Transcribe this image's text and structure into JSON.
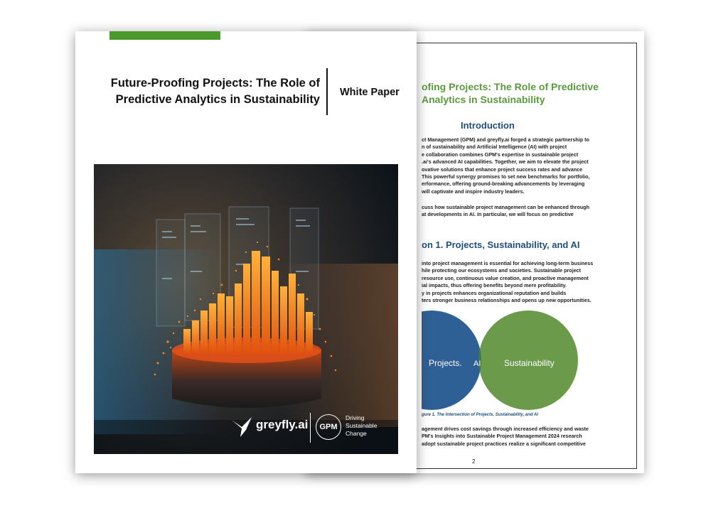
{
  "front": {
    "title_line1": "Future-Proofing Projects: The Role of",
    "title_line2": "Predictive Analytics in Sustainability",
    "doc_type": "White Paper",
    "logo_greyfly": "greyfly.ai",
    "logo_gpm": "GPM",
    "tagline_line1": "Driving",
    "tagline_line2": "Sustainable",
    "tagline_line3": "Change"
  },
  "back": {
    "title_line1": "ofing Projects: The Role of Predictive",
    "title_line2": "Analytics in Sustainability",
    "intro_heading": "Introduction",
    "intro_lines": [
      "ct Management (GPM) and greyfly.ai forged a strategic partnership to",
      "n of sustainability and Artificial Intelligence (AI) with project",
      "e collaboration combines GPM's expertise in sustainable project",
      ".ai's advanced AI capabilities. Together, we aim to elevate the project",
      "ovative solutions that enhance project success rates and advance",
      "This powerful synergy promises to set new benchmarks for portfolio,",
      "erformance, offering ground-breaking advancements by leveraging",
      "will captivate and inspire industry leaders."
    ],
    "intro2_lines": [
      "cuss how sustainable project management can be enhanced through",
      "at developments in AI. In particular, we will focus on predictive"
    ],
    "section_heading": "on 1. Projects, Sustainability, and AI",
    "section_lines": [
      "into project management is essential for achieving long-term business",
      "hile protecting our ecosystems and societies. Sustainable project",
      "resource use, continuous value creation, and proactive management",
      "ial impacts, thus offering benefits beyond mere profitability.",
      "y in projects enhances organizational reputation and builds",
      "ters stronger business relationships and opens up new opportunities."
    ],
    "venn_left": "Projects.",
    "venn_center": "AI",
    "venn_right": "Sustainability",
    "caption": "gure 1. The Intersection of Projects, Sustainability, and AI",
    "closing_lines": [
      "agement drives cost savings through increased efficiency and waste",
      "PM's Insights into Sustainable Project Management 2024 research",
      "adopt sustainable project practices realize a significant competitive"
    ],
    "page_number": "2"
  },
  "colors": {
    "accent_green": "#4c9a2e",
    "heading_blue": "#1f4e79",
    "venn_blue": "#2e5f95",
    "venn_green": "#6a9a4a",
    "venn_overlap": "#3e7a3c"
  }
}
